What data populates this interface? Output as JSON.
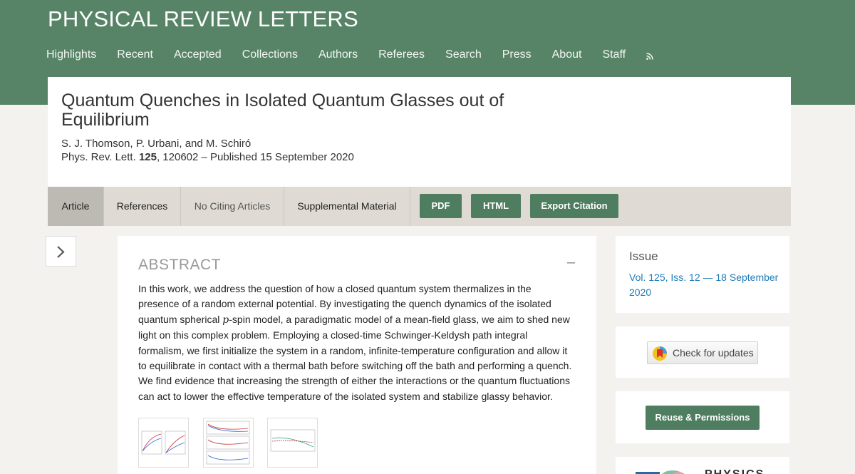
{
  "header": {
    "journal_title": "PHYSICAL REVIEW LETTERS",
    "nav": [
      "Highlights",
      "Recent",
      "Accepted",
      "Collections",
      "Authors",
      "Referees",
      "Search",
      "Press",
      "About",
      "Staff"
    ],
    "rss_icon": "rss-icon"
  },
  "article": {
    "title": "Quantum Quenches in Isolated Quantum Glasses out of Equilibrium",
    "authors": "S. J. Thomson, P. Urbani, and M. Schiró",
    "journal_abbrev": "Phys. Rev. Lett.",
    "volume": "125",
    "cite_rest": ", 120602 – Published 15 September 2020"
  },
  "tabs": {
    "article": "Article",
    "references": "References",
    "citing": "No Citing Articles",
    "supplemental": "Supplemental Material",
    "pdf": "PDF",
    "html": "HTML",
    "export": "Export Citation"
  },
  "abstract": {
    "heading": "ABSTRACT",
    "collapse": "–",
    "text_before": "In this work, we address the question of how a closed quantum system thermalizes in the presence of a random external potential. By investigating the quench dynamics of the isolated quantum spherical ",
    "p_symbol": "p",
    "text_after": "-spin model, a paradigmatic model of a mean-field glass, we aim to shed new light on this complex problem. Employing a closed-time Schwinger-Keldysh path integral formalism, we first initialize the system in a random, infinite-temperature configuration and allow it to equilibrate in contact with a thermal bath before switching off the bath and performing a quench. We find evidence that increasing the strength of either the interactions or the quantum fluctuations can act to lower the effective temperature of the isolated system and stabilize glassy behavior."
  },
  "sidebar": {
    "issue_label": "Issue",
    "issue_link": "Vol. 125, Iss. 12 — 18 September 2020",
    "check_updates": "Check for updates",
    "reuse": "Reuse & Permissions",
    "physics_logo_text": "PHYSICS"
  },
  "colors": {
    "header_green": "#578467",
    "button_green": "#4e7d5f",
    "link_blue": "#1f7bb8",
    "tab_bg": "#dfdbd4"
  }
}
